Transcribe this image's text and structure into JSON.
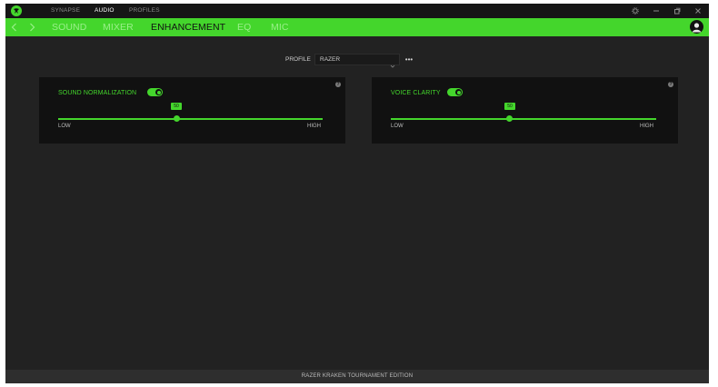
{
  "titlebar": {
    "tabs": [
      {
        "label": "SYNAPSE",
        "active": false
      },
      {
        "label": "AUDIO",
        "active": true
      },
      {
        "label": "PROFILES",
        "active": false
      }
    ],
    "controls": [
      "gear-icon",
      "minimize-icon",
      "maximize-icon",
      "close-icon"
    ]
  },
  "navbar": {
    "tabs": [
      {
        "label": "SOUND",
        "active": false
      },
      {
        "label": "MIXER",
        "active": false
      },
      {
        "label": "ENHANCEMENT",
        "active": true
      },
      {
        "label": "EQ",
        "active": false
      },
      {
        "label": "MIC",
        "active": false
      }
    ]
  },
  "profile": {
    "label": "PROFILE",
    "selected": "RAZER",
    "more": "•••"
  },
  "panels": [
    {
      "title": "SOUND NORMALIZATION",
      "enabled": true,
      "slider": {
        "value": "50",
        "low": "LOW",
        "high": "HIGH",
        "fraction": 0.45
      }
    },
    {
      "title": "VOICE CLARITY",
      "enabled": true,
      "slider": {
        "value": "50",
        "low": "LOW",
        "high": "HIGH",
        "fraction": 0.45
      }
    }
  ],
  "footer": {
    "device": "RAZER KRAKEN TOURNAMENT EDITION"
  },
  "colors": {
    "accent": "#44d62c",
    "background": "#222222",
    "panel": "#111111"
  }
}
